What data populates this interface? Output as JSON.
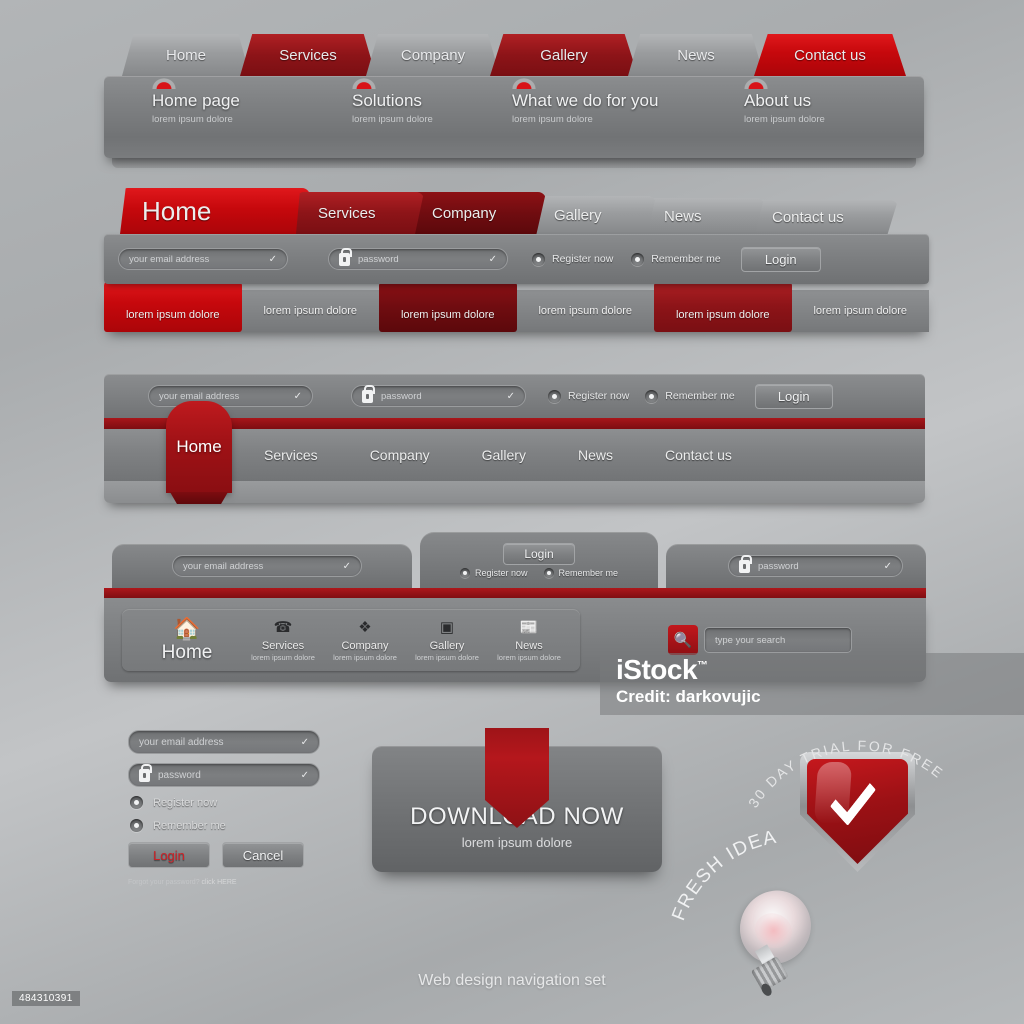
{
  "page": {
    "caption": "Web design navigation set",
    "id": "484310391"
  },
  "watermark": {
    "brand": "iStock",
    "tm": "™",
    "credit": "Credit: darkovujic"
  },
  "colors": {
    "accent_red": "#b02024",
    "bright_red": "#d1171c",
    "dark_red": "#7d0d11",
    "gray": "#7d7f81",
    "background": "#aaadaf"
  },
  "block1": {
    "tabs": [
      {
        "label": "Home",
        "state": "gray"
      },
      {
        "label": "Services",
        "state": "red"
      },
      {
        "label": "Company",
        "state": "gray"
      },
      {
        "label": "Gallery",
        "state": "red"
      },
      {
        "label": "News",
        "state": "gray"
      },
      {
        "label": "Contact us",
        "state": "bright"
      }
    ],
    "dropdown": [
      {
        "title": "Home page",
        "sub": "lorem ipsum dolore"
      },
      {
        "title": "Solutions",
        "sub": "lorem ipsum dolore"
      },
      {
        "title": "What we do for you",
        "sub": "lorem ipsum dolore"
      },
      {
        "title": "About us",
        "sub": "lorem ipsum dolore"
      }
    ]
  },
  "block2": {
    "tabs": [
      {
        "label": "Home",
        "state": "bright"
      },
      {
        "label": "Services",
        "state": "red"
      },
      {
        "label": "Company",
        "state": "dark"
      },
      {
        "label": "Gallery",
        "state": "gray"
      },
      {
        "label": "News",
        "state": "gray"
      },
      {
        "label": "Contact us",
        "state": "gray"
      }
    ],
    "form": {
      "email_placeholder": "your email address",
      "password_placeholder": "password",
      "register_label": "Register now",
      "remember_label": "Remember me",
      "login_label": "Login",
      "check_glyph": "✓"
    },
    "buttons": [
      {
        "label": "lorem ipsum dolore",
        "state": "bright"
      },
      {
        "label": "lorem ipsum dolore",
        "state": "gray"
      },
      {
        "label": "lorem ipsum dolore",
        "state": "dark"
      },
      {
        "label": "lorem ipsum dolore",
        "state": "gray"
      },
      {
        "label": "lorem ipsum dolore",
        "state": "red"
      },
      {
        "label": "lorem ipsum dolore",
        "state": "gray"
      }
    ]
  },
  "block3": {
    "form": {
      "email_placeholder": "your email address",
      "password_placeholder": "password",
      "register_label": "Register now",
      "remember_label": "Remember me",
      "login_label": "Login",
      "check_glyph": "✓"
    },
    "home_label": "Home",
    "nav": [
      "Services",
      "Company",
      "Gallery",
      "News",
      "Contact us"
    ]
  },
  "block4": {
    "form": {
      "email_placeholder": "your email address",
      "password_placeholder": "password",
      "register_label": "Register now",
      "remember_label": "Remember me",
      "login_label": "Login",
      "check_glyph": "✓"
    },
    "home_label": "Home",
    "home_icon": "home-icon",
    "menu": [
      {
        "label": "Services",
        "sub": "lorem ipsum dolore",
        "icon": "telephone-icon"
      },
      {
        "label": "Company",
        "sub": "lorem ipsum dolore",
        "icon": "building-blocks-icon"
      },
      {
        "label": "Gallery",
        "sub": "lorem ipsum dolore",
        "icon": "picture-icon"
      },
      {
        "label": "News",
        "sub": "lorem ipsum dolore",
        "icon": "newspaper-icon"
      }
    ],
    "search_placeholder": "type your search",
    "search_icon": "magnifier-icon"
  },
  "login_form": {
    "email_placeholder": "your email address",
    "password_placeholder": "password",
    "register_label": "Register now",
    "remember_label": "Remember me",
    "login_label": "Login",
    "cancel_label": "Cancel",
    "forgot_text": "Forgot your password?",
    "forgot_link": "click HERE",
    "check_glyph": "✓"
  },
  "download": {
    "title": "DOWNLOAD NOW",
    "subtitle": "lorem ipsum dolore"
  },
  "badge": {
    "arc_text": "30 DAY TRIAL FOR FREE",
    "icon": "shield-check-icon"
  },
  "idea": {
    "arc_text": "FRESH IDEA",
    "icon": "lightbulb-icon"
  }
}
